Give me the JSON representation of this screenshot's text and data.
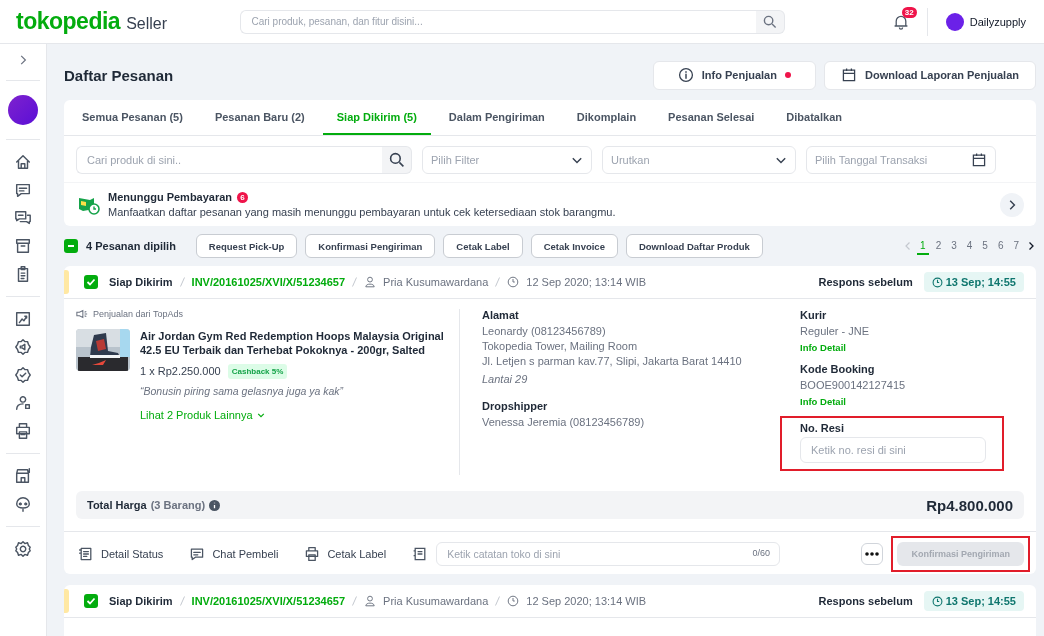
{
  "header": {
    "logo": "tokopedia",
    "logo_suffix": "Seller",
    "search_placeholder": "Cari produk, pesanan, dan fitur disini...",
    "notification_count": "32",
    "shop_name": "Dailyzupply"
  },
  "page": {
    "title": "Daftar Pesanan",
    "buttons": [
      {
        "kind": "info",
        "label": "Info Penjualan",
        "has_dot": true
      },
      {
        "kind": "download",
        "label": "Download Laporan Penjualan",
        "has_dot": false
      }
    ]
  },
  "tabs": [
    {
      "label": "Semua Pesanan (5)",
      "selected": false
    },
    {
      "label": "Pesanan Baru (2)",
      "selected": false
    },
    {
      "label": "Siap Dikirim (5)",
      "selected": true
    },
    {
      "label": "Dalam Pengiriman",
      "selected": false
    },
    {
      "label": "Dikomplain",
      "selected": false
    },
    {
      "label": "Pesanan Selesai",
      "selected": false
    },
    {
      "label": "Dibatalkan",
      "selected": false
    }
  ],
  "filters": {
    "search_placeholder": "Cari produk di sini..",
    "filter_placeholder": "Pilih Filter",
    "sort_placeholder": "Urutkan",
    "date_placeholder": "Pilih Tanggal Transaksi"
  },
  "banner": {
    "title": "Menunggu Pembayaran",
    "count": "6",
    "text": "Manfaatkan daftar pesanan yang masih menunggu pembayaran untuk cek ketersediaan stok barangmu."
  },
  "bulk": {
    "partial": true,
    "label": "4 Pesanan dipilih",
    "actions": [
      "Request Pick-Up",
      "Konfirmasi Pengiriman",
      "Cetak Label",
      "Cetak Invoice",
      "Download Daftar Produk"
    ]
  },
  "pagination": {
    "pages": [
      {
        "label": "1",
        "selected": true
      },
      {
        "label": "2",
        "selected": false
      },
      {
        "label": "3",
        "selected": false
      },
      {
        "label": "4",
        "selected": false
      },
      {
        "label": "5",
        "selected": false
      },
      {
        "label": "6",
        "selected": false
      },
      {
        "label": "7",
        "selected": false
      }
    ]
  },
  "orders": [
    {
      "checked": true,
      "expanded": true,
      "status": "Siap Dikirim",
      "invoice": "INV/20161025/XVI/X/51234657",
      "buyer": "Pria Kusumawardana",
      "date": "12 Sep 2020; 13:14 WIB",
      "respond_label": "Respons sebelum",
      "deadline": "13 Sep; 14:55",
      "source": "Penjualan dari TopAds",
      "product": {
        "kind": "picture",
        "name": "Air Jordan Gym Red Redemption Hoops Malaysia Original 42.5 EU Terbaik dan Terhebat Pokoknya - 200gr, Salted",
        "qty_price": "1 x Rp2.250.000",
        "cashback": "Cashback 5%",
        "note": "“Bonusin piring sama gelasnya juga ya kak”"
      },
      "more_link": "Lihat 2 Produk Lainnya",
      "address": {
        "label": "Alamat",
        "lines": [
          "Leonardy (08123456789)",
          "Tokopedia Tower, Mailing Room",
          "Jl. Letjen s parman kav.77, Slipi, Jakarta Barat 14410"
        ],
        "note": "Lantai 29"
      },
      "dropshipper": {
        "label": "Dropshipper",
        "value": "Venessa Jeremia (08123456789)"
      },
      "courier": {
        "label": "Kurir",
        "value": "Reguler - JNE",
        "link": "Info Detail"
      },
      "booking": {
        "label": "Kode Booking",
        "value": "BOOE900142127415",
        "link": "Info Detail"
      },
      "resi": {
        "label": "No. Resi",
        "placeholder": "Ketik no. resi di sini",
        "highlighted": true
      },
      "total": {
        "label": "Total Harga",
        "count": "(3 Barang)",
        "amount": "Rp4.800.000"
      },
      "footer": {
        "actions": [
          {
            "kind": "status",
            "label": "Detail Status"
          },
          {
            "kind": "chat",
            "label": "Chat Pembeli"
          },
          {
            "kind": "print",
            "label": "Cetak Label"
          }
        ],
        "note_placeholder": "Ketik catatan toko di sini",
        "note_counter": "0/60",
        "confirm": {
          "label": "Konfirmasi Pengiriman",
          "disabled": true,
          "highlighted": true
        }
      }
    },
    {
      "checked": true,
      "expanded": false,
      "status": "Siap Dikirim",
      "invoice": "INV/20161025/XVI/X/51234657",
      "buyer": "Pria Kusumawardana",
      "date": "12 Sep 2020; 13:14 WIB",
      "respond_label": "Respons sebelum",
      "deadline": "13 Sep; 14:55"
    }
  ]
}
